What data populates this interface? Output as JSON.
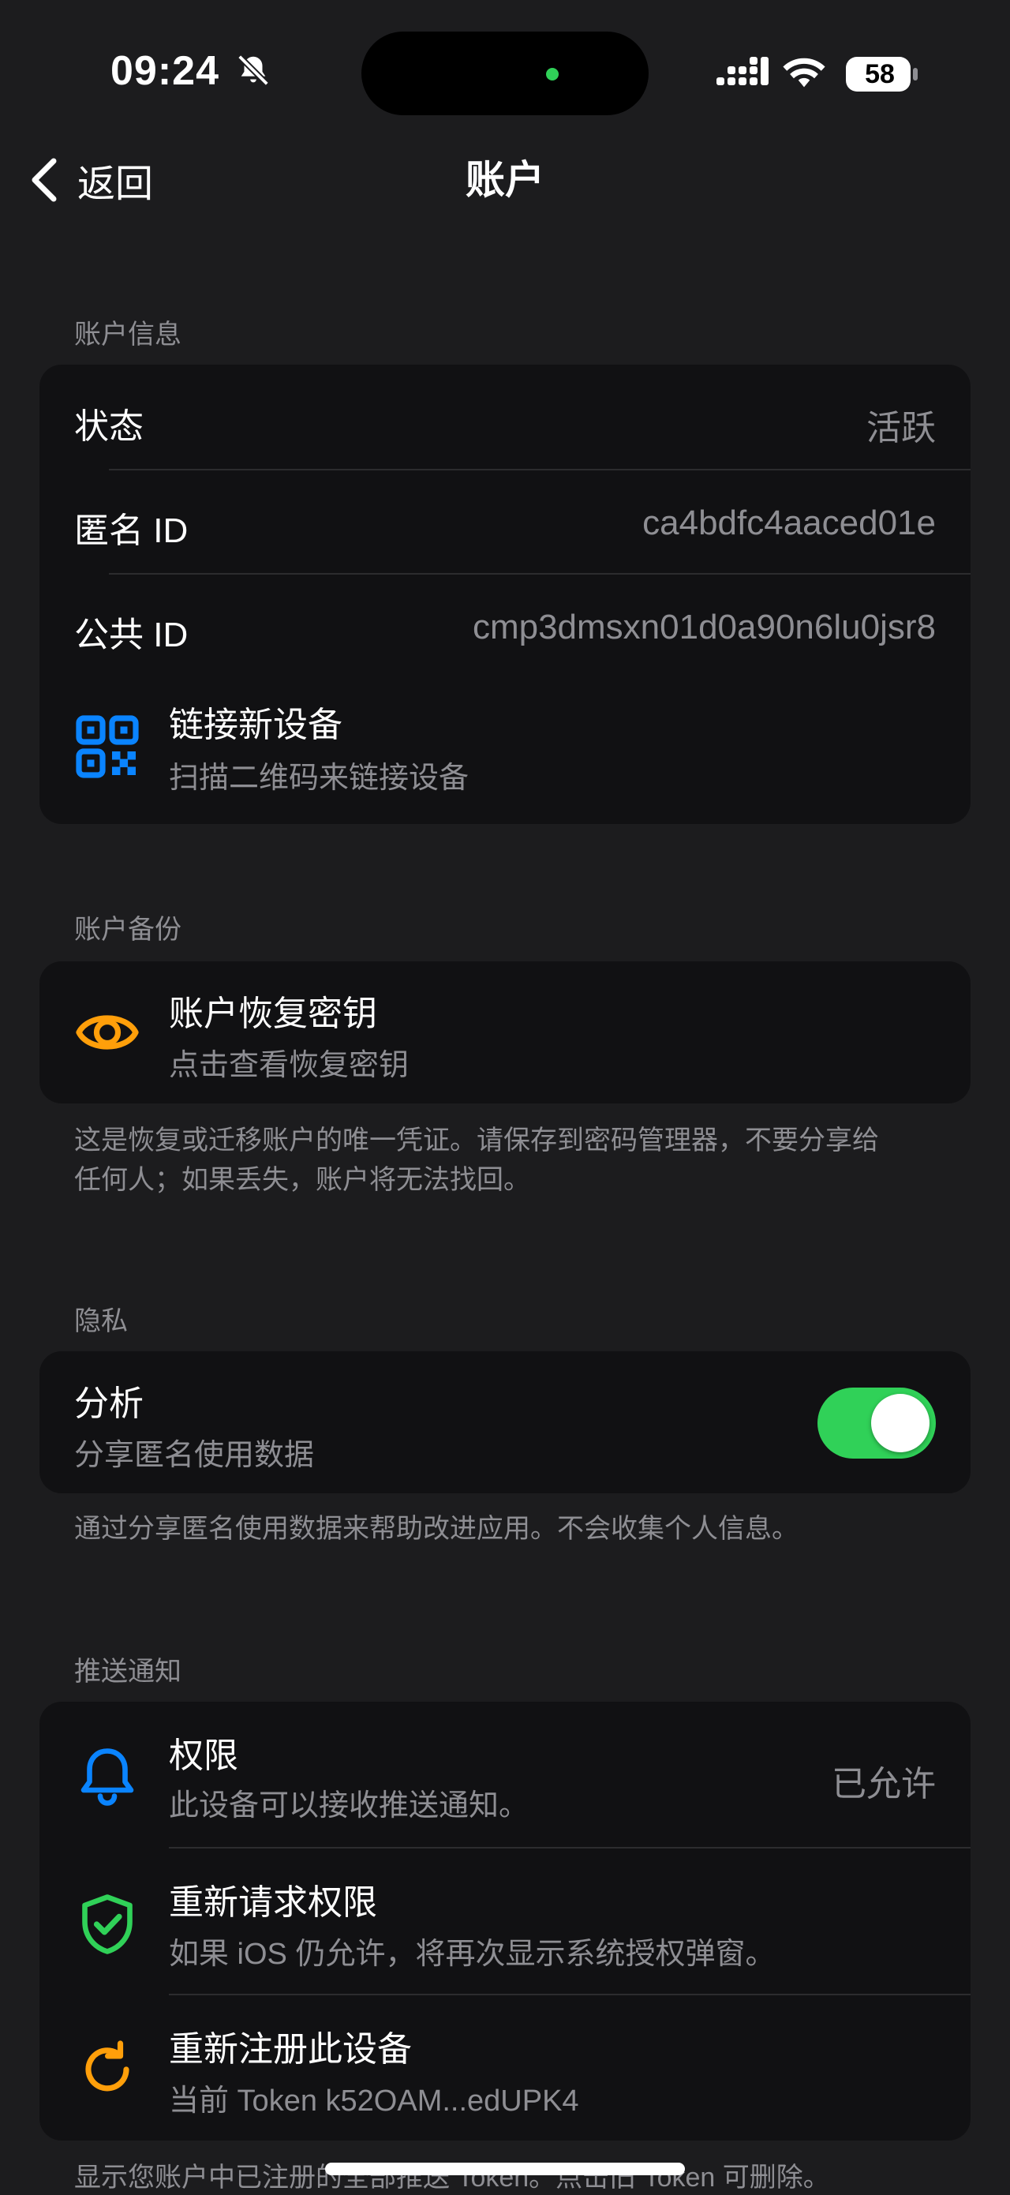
{
  "status_bar": {
    "time": "09:24",
    "battery": "58",
    "icons": [
      "bell-slash-icon",
      "signal-icon",
      "wifi-icon",
      "battery-icon"
    ]
  },
  "nav": {
    "back_label": "返回",
    "title": "账户"
  },
  "account_info": {
    "header": "账户信息",
    "status_label": "状态",
    "status_value": "活跃",
    "anon_id_label": "匿名 ID",
    "anon_id_value": "ca4bdfc4aaced01e",
    "public_id_label": "公共 ID",
    "public_id_value": "cmp3dmsxn01d0a90n6lu0jsr8",
    "link_device_title": "链接新设备",
    "link_device_subtitle": "扫描二维码来链接设备"
  },
  "backup": {
    "header": "账户备份",
    "key_title": "账户恢复密钥",
    "key_subtitle": "点击查看恢复密钥",
    "footer_line1": "这是恢复或迁移账户的唯一凭证。请保存到密码管理器，不要分享给",
    "footer_line2": "任何人；如果丢失，账户将无法找回。"
  },
  "privacy": {
    "header": "隐私",
    "analytics_title": "分析",
    "analytics_subtitle": "分享匿名使用数据",
    "analytics_enabled": true,
    "footer": "通过分享匿名使用数据来帮助改进应用。不会收集个人信息。"
  },
  "push": {
    "header": "推送通知",
    "permission_title": "权限",
    "permission_subtitle": "此设备可以接收推送通知。",
    "permission_value": "已允许",
    "rerequest_title": "重新请求权限",
    "rerequest_subtitle": "如果 iOS 仍允许，将再次显示系统授权弹窗。",
    "reregister_title": "重新注册此设备",
    "reregister_subtitle": "当前 Token k52OAM...edUPK4",
    "footer": "显示您账户中已注册的全部推送 Token。点击旧 Token 可删除。"
  },
  "colors": {
    "background": "#1c1c1e",
    "card": "#111113",
    "secondary_text": "#8e8e93",
    "accent_blue": "#0a84ff",
    "accent_orange": "#ff9f0a",
    "accent_green": "#30d158"
  }
}
